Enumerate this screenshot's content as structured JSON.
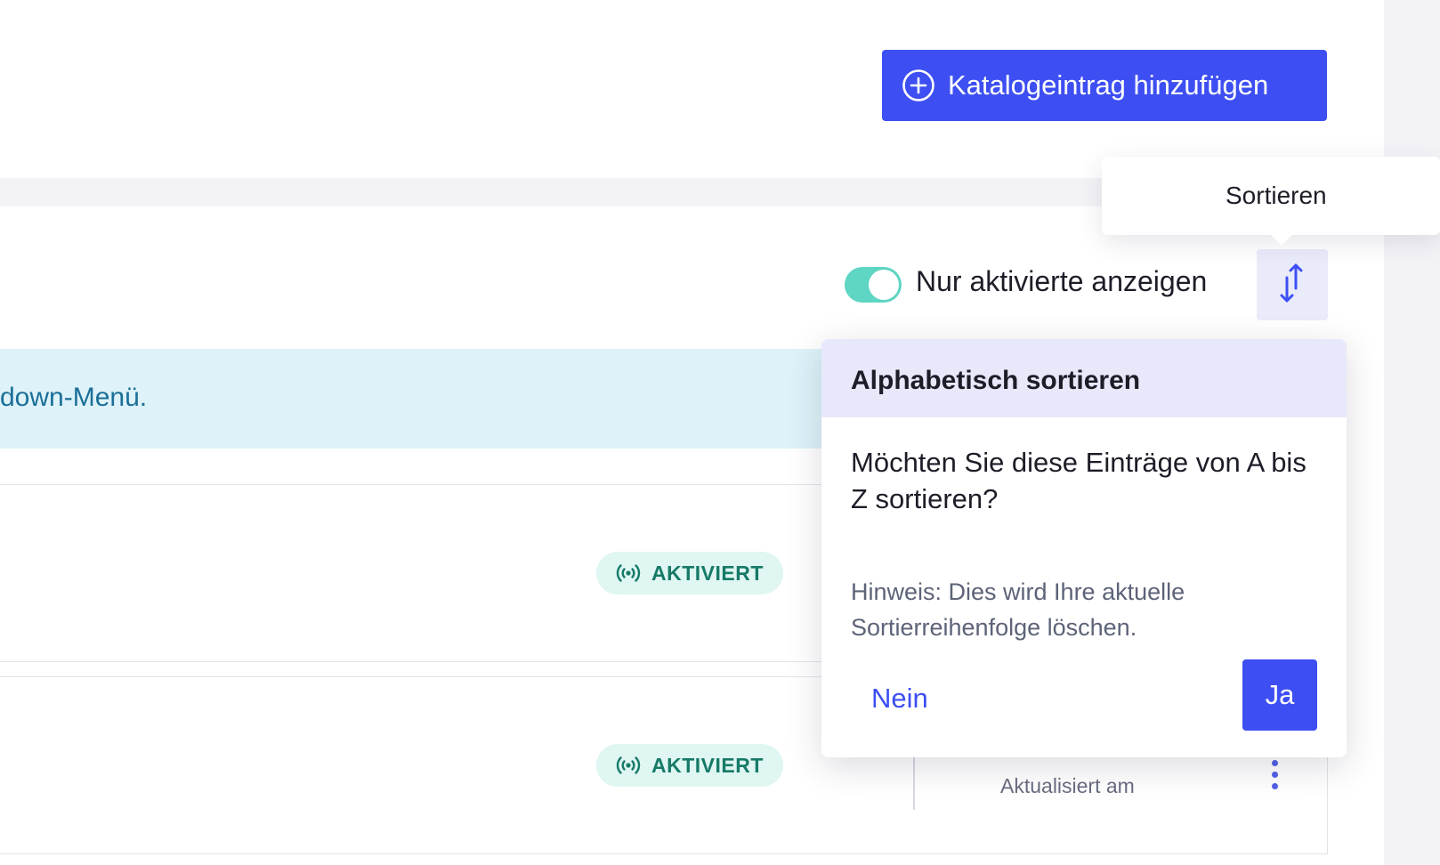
{
  "header": {
    "add_button_label": "Katalogeintrag hinzufügen"
  },
  "filters": {
    "toggle_label": "Nur aktivierte anzeigen",
    "toggle_on": true
  },
  "sort": {
    "tooltip": "Sortieren"
  },
  "info_banner": {
    "text": "down-Menü."
  },
  "rows": [
    {
      "status": "AKTIVIERT"
    },
    {
      "status": "AKTIVIERT",
      "updated_label": "Aktualisiert am"
    }
  ],
  "sort_dialog": {
    "title": "Alphabetisch sortieren",
    "question": "Möchten Sie diese Einträge von A bis Z sortieren?",
    "hint": "Hinweis: Dies wird Ihre aktuelle Sortierreihenfolge löschen.",
    "no_label": "Nein",
    "yes_label": "Ja"
  },
  "colors": {
    "primary": "#3d4ff2",
    "toggle": "#5fd5c3",
    "badge_bg": "#dff6f2",
    "badge_text": "#167a68",
    "info_bg": "#ddf2f9",
    "dialog_head": "#e8e8fb"
  },
  "icons": {
    "add": "plus-circle-icon",
    "sort": "sort-arrows-icon",
    "status": "broadcast-icon",
    "menu": "kebab-menu-icon"
  }
}
